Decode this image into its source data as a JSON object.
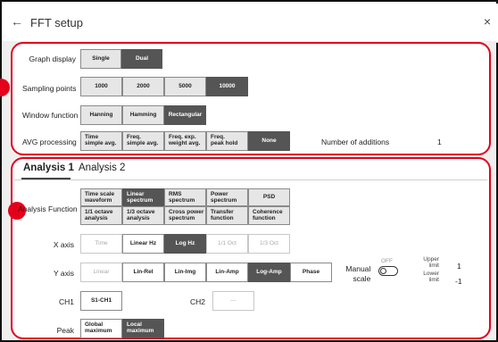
{
  "window": {
    "title": "FFT setup",
    "back_icon": "←",
    "close_icon": "×"
  },
  "settings": {
    "graph_display": {
      "label": "Graph display",
      "options": [
        "Single",
        "Dual"
      ],
      "selected": "Dual"
    },
    "sampling_points": {
      "label": "Sampling points",
      "options": [
        "1000",
        "2000",
        "5000",
        "10000"
      ],
      "selected": "10000"
    },
    "window_function": {
      "label": "Window function",
      "options": [
        "Hanning",
        "Hamming",
        "Rectangular"
      ],
      "selected": "Rectangular"
    },
    "avg_processing": {
      "label": "AVG processing",
      "options": [
        {
          "line1": "Time",
          "line2": "simple avg."
        },
        {
          "line1": "Freq.",
          "line2": "simple avg."
        },
        {
          "line1": "Freq. exp.",
          "line2": "weight avg."
        },
        {
          "line1": "Freq.",
          "line2": "peak hold"
        },
        {
          "line1": "None",
          "line2": ""
        }
      ],
      "selected": "None",
      "number_of_additions_label": "Number of additions",
      "number_of_additions_value": "1"
    }
  },
  "analysis": {
    "tabs": [
      "Analysis 1",
      "Analysis 2"
    ],
    "active_tab": "Analysis 1",
    "analysis_function": {
      "label": "Analysis Function",
      "row1": [
        {
          "line1": "Time scale",
          "line2": "waveform"
        },
        {
          "line1": "Linear",
          "line2": "spectrum"
        },
        {
          "line1": "RMS",
          "line2": "spectrum"
        },
        {
          "line1": "Power",
          "line2": "spectrum"
        },
        {
          "line1": "PSD",
          "line2": ""
        }
      ],
      "row2": [
        {
          "line1": "1/1 octave",
          "line2": "analysis"
        },
        {
          "line1": "1/3 octave",
          "line2": "analysis"
        },
        {
          "line1": "Cross power",
          "line2": "spectrum"
        },
        {
          "line1": "Transfer",
          "line2": "function"
        },
        {
          "line1": "Coherence",
          "line2": "function"
        }
      ],
      "selected": "Linear spectrum"
    },
    "x_axis": {
      "label": "X axis",
      "options": [
        "Time",
        "Linear Hz",
        "Log Hz",
        "1/1 Oct",
        "1/3 Oct"
      ],
      "selected": "Log Hz"
    },
    "y_axis": {
      "label": "Y axis",
      "options": [
        "Linear",
        "Lin-Rel",
        "Lin-Img",
        "Lin-Amp",
        "Log-Amp",
        "Phase"
      ],
      "selected": "Log-Amp"
    },
    "manual_scale": {
      "label_line1": "Manual",
      "label_line2": "scale",
      "state": "OFF"
    },
    "upper_limit": {
      "label_line1": "Upper",
      "label_line2": "limit",
      "value": "1"
    },
    "lower_limit": {
      "label_line1": "Lower",
      "label_line2": "limit",
      "value": "-1"
    },
    "ch1": {
      "label": "CH1",
      "value": "S1-CH1"
    },
    "ch2": {
      "label": "CH2",
      "value": "---"
    },
    "peak": {
      "label": "Peak",
      "options": [
        {
          "line1": "Global",
          "line2": "maximum"
        },
        {
          "line1": "Local",
          "line2": "maximum"
        }
      ],
      "selected": "Local maximum"
    }
  },
  "colors": {
    "highlight": "#e4001b",
    "selected": "#555555",
    "button": "#e6e6e6"
  }
}
